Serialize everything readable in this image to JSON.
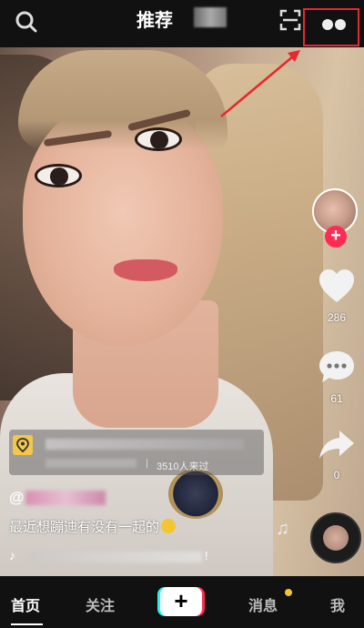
{
  "header": {
    "title": "推荐"
  },
  "side": {
    "like_count": "286",
    "comment_count": "61",
    "share_count": "0"
  },
  "poi": {
    "separator": "|",
    "visitors": "3510人来过"
  },
  "video_info": {
    "username_prefix": "@",
    "caption": "最近想蹦迪有没有一起的",
    "music_tail": "!"
  },
  "nav": {
    "home": "首页",
    "following": "关注",
    "create": "+",
    "messages": "消息",
    "me": "我"
  },
  "icons": {
    "search": "search-icon",
    "scan": "scan-icon",
    "more": "dots-icon",
    "like": "heart-icon",
    "comment": "comment-icon",
    "share": "share-icon",
    "location": "location-icon",
    "music": "tiktok-note-icon"
  },
  "colors": {
    "accent_red": "#fe2c55",
    "accent_cyan": "#25f4ee",
    "notification": "#f7c32e",
    "annotation_red": "#e8272f"
  }
}
